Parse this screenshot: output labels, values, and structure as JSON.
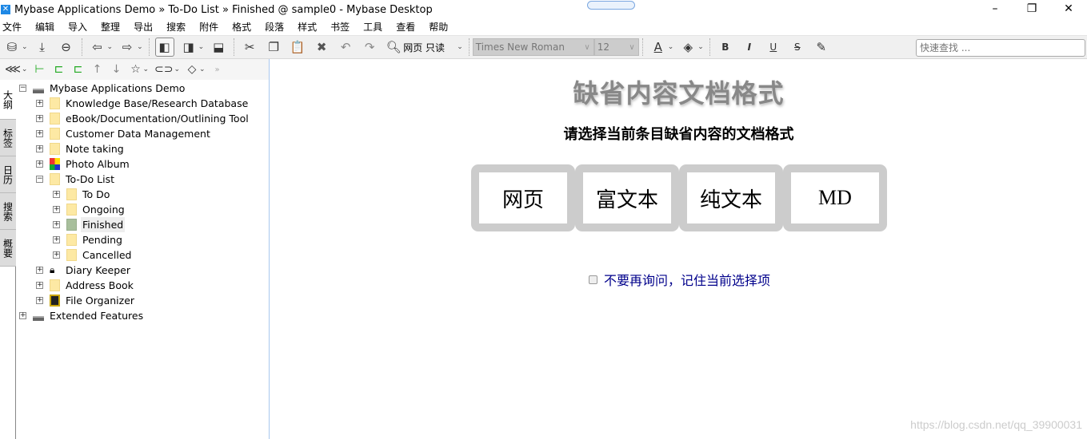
{
  "window": {
    "title": "Mybase Applications Demo » To-Do List » Finished @ sample0 - Mybase Desktop",
    "minimize": "–",
    "maximize": "❐",
    "close": "✕"
  },
  "menu": [
    "文件",
    "编辑",
    "导入",
    "整理",
    "导出",
    "搜索",
    "附件",
    "格式",
    "段落",
    "样式",
    "书签",
    "工具",
    "查看",
    "帮助"
  ],
  "toolbar": {
    "view_mode": "网页 只读",
    "font": "Times New Roman",
    "font_size": "12",
    "quickfind_placeholder": "快速查找 ..."
  },
  "side_tabs": [
    "大纲",
    "标签",
    "日历",
    "搜索",
    "概要"
  ],
  "tree": [
    {
      "label": "Mybase Applications Demo",
      "level": 0,
      "icon": "drive",
      "expanded": true
    },
    {
      "label": "Knowledge Base/Research Database",
      "level": 1,
      "icon": "folder"
    },
    {
      "label": "eBook/Documentation/Outlining Tool",
      "level": 1,
      "icon": "folder"
    },
    {
      "label": "Customer Data Management",
      "level": 1,
      "icon": "folder"
    },
    {
      "label": "Note taking",
      "level": 1,
      "icon": "folder"
    },
    {
      "label": "Photo Album",
      "level": 1,
      "icon": "photo"
    },
    {
      "label": "To-Do List",
      "level": 1,
      "icon": "folder",
      "expanded": true
    },
    {
      "label": "To Do",
      "level": 2,
      "icon": "folder"
    },
    {
      "label": "Ongoing",
      "level": 2,
      "icon": "folder"
    },
    {
      "label": "Finished",
      "level": 2,
      "icon": "folder-green",
      "selected": true
    },
    {
      "label": "Pending",
      "level": 2,
      "icon": "folder"
    },
    {
      "label": "Cancelled",
      "level": 2,
      "icon": "folder"
    },
    {
      "label": "Diary Keeper",
      "level": 1,
      "icon": "lock"
    },
    {
      "label": "Address Book",
      "level": 1,
      "icon": "folder"
    },
    {
      "label": "File Organizer",
      "level": 1,
      "icon": "floppy"
    },
    {
      "label": "Extended Features",
      "level": 0,
      "icon": "drive"
    }
  ],
  "content": {
    "title": "缺省内容文档格式",
    "subtitle": "请选择当前条目缺省内容的文档格式",
    "formats": [
      "网页",
      "富文本",
      "纯文本",
      "MD"
    ],
    "remember_label": "不要再询问，记住当前选择项",
    "remember_checked": false
  },
  "watermark": "https://blog.csdn.net/qq_39900031"
}
